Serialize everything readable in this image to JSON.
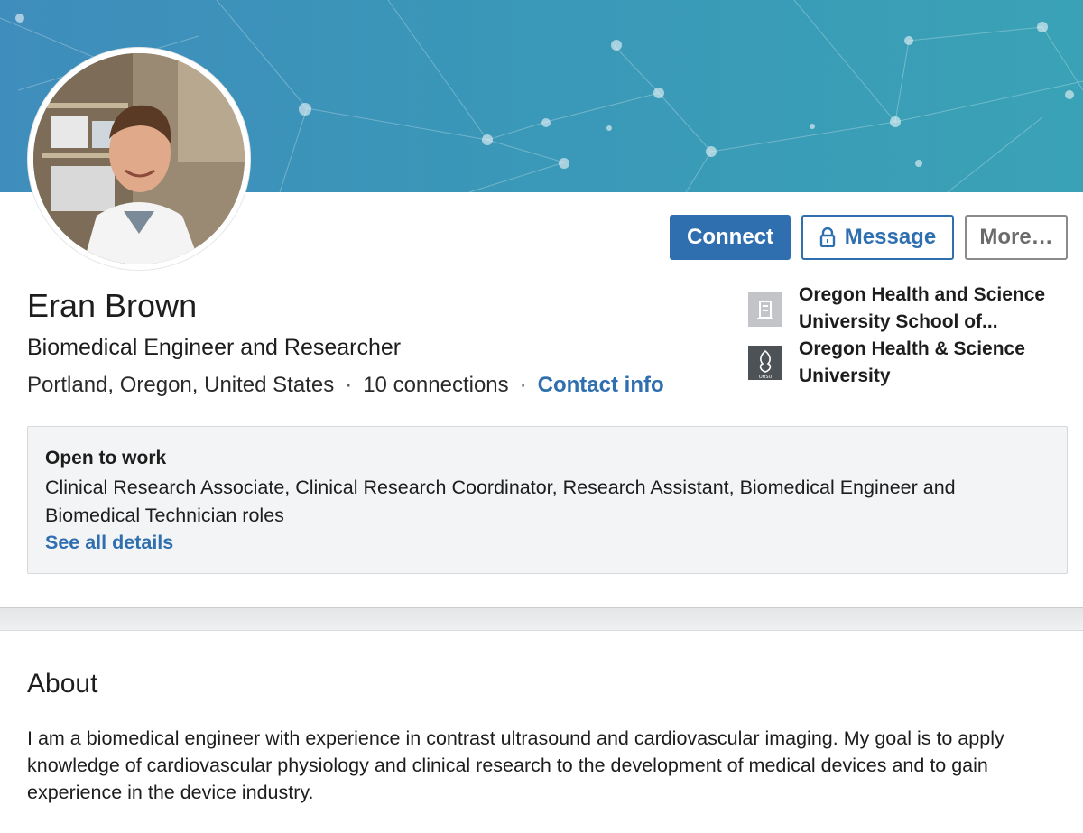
{
  "colors": {
    "accent": "#2f6fb0",
    "banner_start": "#3f8dbc",
    "banner_end": "#3aa2b6",
    "panel_bg": "#f3f4f6"
  },
  "profile": {
    "name": "Eran Brown",
    "headline": "Biomedical Engineer and Researcher",
    "location": "Portland, Oregon, United States",
    "connections": "10 connections",
    "contact_label": "Contact info",
    "separator": "·"
  },
  "actions": {
    "connect_label": "Connect",
    "message_label": "Message",
    "more_label": "More…"
  },
  "education": [
    {
      "name_line1": "Oregon Health and Science",
      "name_line2": "University School of...",
      "icon": "building-icon"
    },
    {
      "name_line1": "Oregon Health & Science",
      "name_line2": "University",
      "icon": "ohsu-logo",
      "logo_text": "OHSU"
    }
  ],
  "open_to_work": {
    "title": "Open to work",
    "roles": "Clinical Research Associate, Clinical Research Coordinator, Research Assistant, Biomedical Engineer and Biomedical Technician roles",
    "link_label": "See all details"
  },
  "about": {
    "title": "About",
    "body": "I am a biomedical engineer with experience in contrast ultrasound and cardiovascular imaging. My goal is to apply knowledge of cardiovascular physiology and clinical research to the development of medical devices and to gain experience in the device industry."
  }
}
